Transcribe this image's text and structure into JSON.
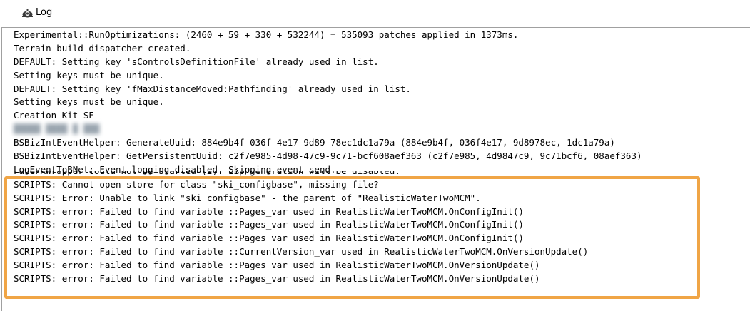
{
  "window": {
    "title": "Log",
    "icon": "gear-icon"
  },
  "log": {
    "lines": [
      "Experimental::RunOptimizations: (2460 + 59 + 330 + 532244) = 535093 patches applied in 1373ms.",
      "Terrain build dispatcher created.",
      "DEFAULT: Setting key 'sControlsDefinitionFile' already used in list.",
      "Setting keys must be unique.",
      "DEFAULT: Setting key 'fMaxDistanceMoved:Pathfinding' already used in list.",
      "Setting keys must be unique.",
      "Creation Kit SE",
      "",
      "BSBizIntEventHelper: GenerateUuid: 884e9b4f-036f-4e17-9d89-78ec1dc1a79a (884e9b4f, 036f4e17, 9d8978ec, 1dc1a79a)",
      "BSBizIntEventHelper: GetPersistentUuid: c2f7e985-4d98-47c9-9c71-bcf608aef363 (c2f7e985, 4d9847c9, 9c71bcf6, 08aef363)",
      "LogEventToBNet: Event logging disabled. Skipping event send.",
      "FaceFXWrapper could not be started (2). Lip generation will be disabled.",
      "SCRIPTS: Cannot open store for class \"ski_configbase\", missing file?",
      "SCRIPTS: Error: Unable to link \"ski_configbase\" - the parent of \"RealisticWaterTwoMCM\".",
      "SCRIPTS: error: Failed to find variable ::Pages_var used in RealisticWaterTwoMCM.OnConfigInit()",
      "SCRIPTS: error: Failed to find variable ::Pages_var used in RealisticWaterTwoMCM.OnConfigInit()",
      "SCRIPTS: error: Failed to find variable ::Pages_var used in RealisticWaterTwoMCM.OnConfigInit()",
      "SCRIPTS: error: Failed to find variable ::CurrentVersion_var used in RealisticWaterTwoMCM.OnVersionUpdate()",
      "SCRIPTS: error: Failed to find variable ::Pages_var used in RealisticWaterTwoMCM.OnVersionUpdate()",
      "SCRIPTS: error: Failed to find variable ::Pages_var used in RealisticWaterTwoMCM.OnVersionUpdate()"
    ],
    "highlight_color": "#f0a546"
  }
}
